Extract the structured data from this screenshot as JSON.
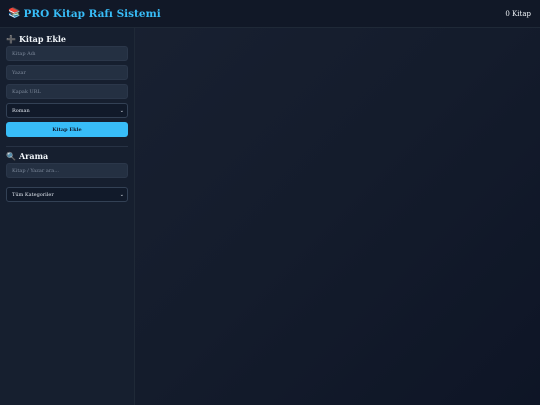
{
  "header": {
    "icon": "📚",
    "title": "PRO Kitap Rafı Sistemi",
    "count": "0 Kitap"
  },
  "add_section": {
    "icon": "➕",
    "title": "Kitap Ekle",
    "book_name_placeholder": "Kitap Adı",
    "author_placeholder": "Yazar",
    "cover_url_placeholder": "Kapak URL",
    "category_selected": "Roman",
    "submit_label": "Kitap Ekle"
  },
  "search_section": {
    "icon": "🔍",
    "title": "Arama",
    "search_placeholder": "Kitap / Yazar ara...",
    "filter_selected": "Tüm Kategoriler"
  },
  "colors": {
    "accent": "#38bdf8",
    "background": "#141c2c"
  }
}
